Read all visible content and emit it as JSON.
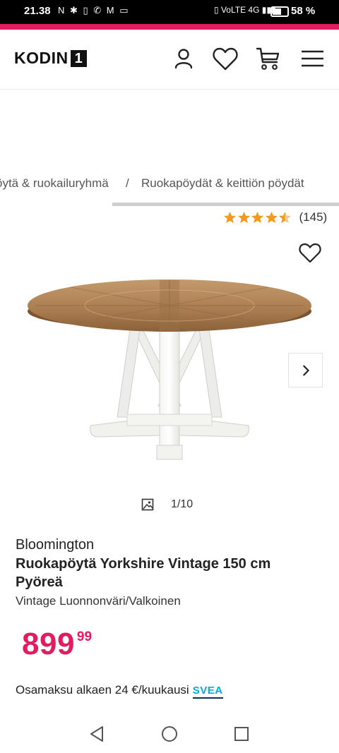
{
  "status_bar": {
    "time": "21.38",
    "left_icons": "N ✱ ▯ ✆ M ▭",
    "right_icons": "▯ VoLTE 4G ▮▮▮",
    "battery": "58 %",
    "battery_level": 0.58
  },
  "header": {
    "logo_text": "KODIN",
    "logo_number": "1",
    "brand_color": "#e31c61"
  },
  "breadcrumb": {
    "items": [
      "öytä & ruokailuryhmä",
      "Ruokapöydät & keittiön pöydät"
    ],
    "separator": "/"
  },
  "rating": {
    "stars": 4.5,
    "count": "(145)",
    "star_color": "#f39a1e"
  },
  "gallery": {
    "counter": "1/10"
  },
  "product": {
    "brand": "Bloomington",
    "title": "Ruokapöytä Yorkshire Vintage 150 cm Pyöreä",
    "variant": "Vintage Luonnonväri/Valkoinen",
    "price_main": "899",
    "price_cents": "99",
    "installment_text": "Osamaksu alkaen 24 €/kuukausi",
    "installment_provider": "SVEA"
  },
  "icons": {
    "account": "user-icon",
    "wishlist": "heart-icon",
    "cart": "cart-icon",
    "menu": "menu-icon",
    "gallery": "image-icon",
    "next": "chevron-right-icon",
    "nav_back": "triangle-back-icon",
    "nav_home": "circle-home-icon",
    "nav_recents": "square-recents-icon"
  }
}
